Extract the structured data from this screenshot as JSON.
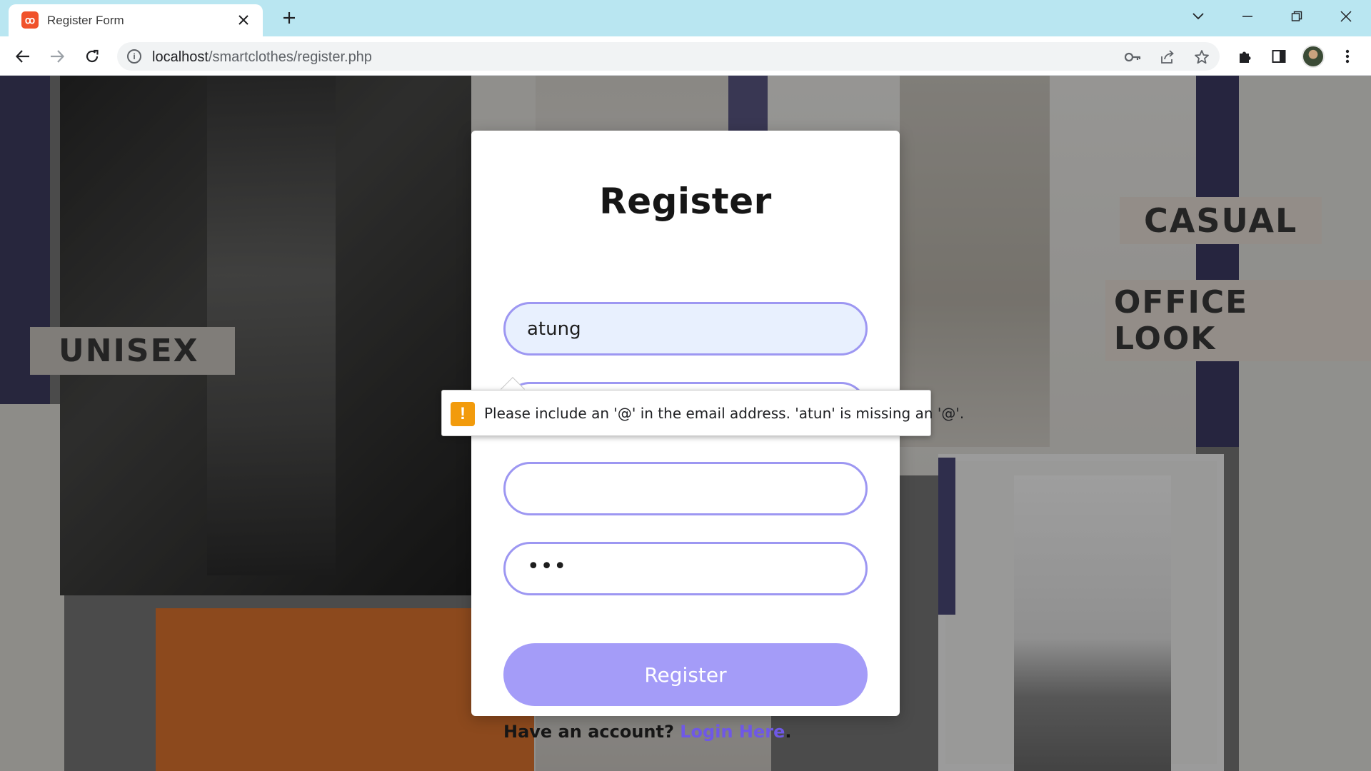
{
  "browser": {
    "tab_title": "Register Form",
    "url_host": "localhost",
    "url_path": "/smartclothes/register.php",
    "favicon_glyph": "ꝏ"
  },
  "background": {
    "labels": [
      "UNISEX",
      "CASUAL",
      "OFFICE LOOK"
    ]
  },
  "form": {
    "title": "Register",
    "fields": [
      {
        "value": "atung",
        "autofill": true
      },
      {
        "value": "atun",
        "focused": true
      },
      {
        "value": ""
      },
      {
        "value": "•••",
        "type": "password"
      }
    ],
    "submit_label": "Register",
    "account_prompt": "Have an account?",
    "login_link": "Login Here",
    "period": "."
  },
  "validation": {
    "icon": "warning-icon",
    "message": "Please include an '@' in the email address. 'atun' is missing an '@'."
  },
  "colors": {
    "accent": "#9d97f2",
    "button": "#a49cf8",
    "link": "#6f58e6",
    "tabbar": "#b9e6f1"
  }
}
